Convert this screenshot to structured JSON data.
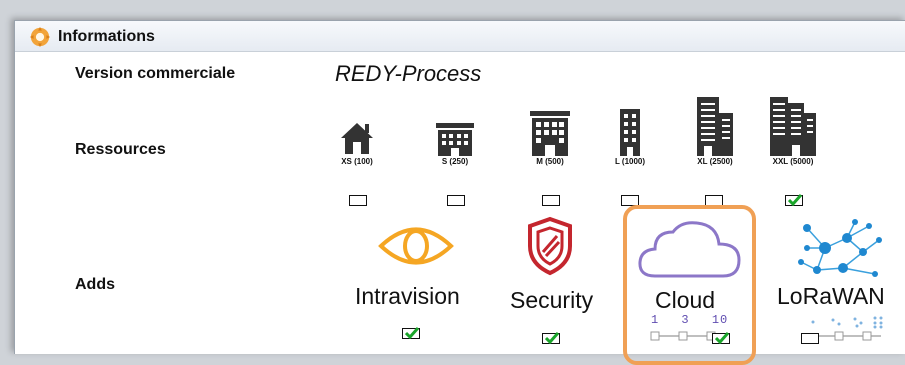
{
  "window": {
    "title": "Informations",
    "title_icon": "gear-icon"
  },
  "version": {
    "label": "Version commerciale",
    "value": "REDY-Process"
  },
  "resources": {
    "label": "Ressources",
    "items": [
      {
        "label": "XS (100)",
        "icon": "house-icon",
        "checked": false
      },
      {
        "label": "S (250)",
        "icon": "small-building-icon",
        "checked": false
      },
      {
        "label": "M (500)",
        "icon": "medium-building-icon",
        "checked": false
      },
      {
        "label": "L (1000)",
        "icon": "tower-building-icon",
        "checked": false
      },
      {
        "label": "XL (2500)",
        "icon": "large-building-icon",
        "checked": false
      },
      {
        "label": "XXL (5000)",
        "icon": "xxl-building-icon",
        "checked": true
      }
    ]
  },
  "adds": {
    "label": "Adds",
    "items": [
      {
        "label": "Intravision",
        "icon": "eye-icon",
        "checked": true
      },
      {
        "label": "Security",
        "icon": "shield-icon",
        "checked": true
      },
      {
        "label": "Cloud",
        "icon": "cloud-icon",
        "checked": true,
        "highlighted": true,
        "scale": [
          "1",
          "3",
          "10"
        ]
      },
      {
        "label": "LoRaWAN",
        "icon": "network-icon",
        "checked": false
      }
    ]
  },
  "colors": {
    "check": "#1aa52a",
    "highlight": "#f0a055",
    "cloud": "#8c77c8",
    "eye": "#f5a623",
    "shield": "#c4262e",
    "network": "#3aa0dd"
  }
}
